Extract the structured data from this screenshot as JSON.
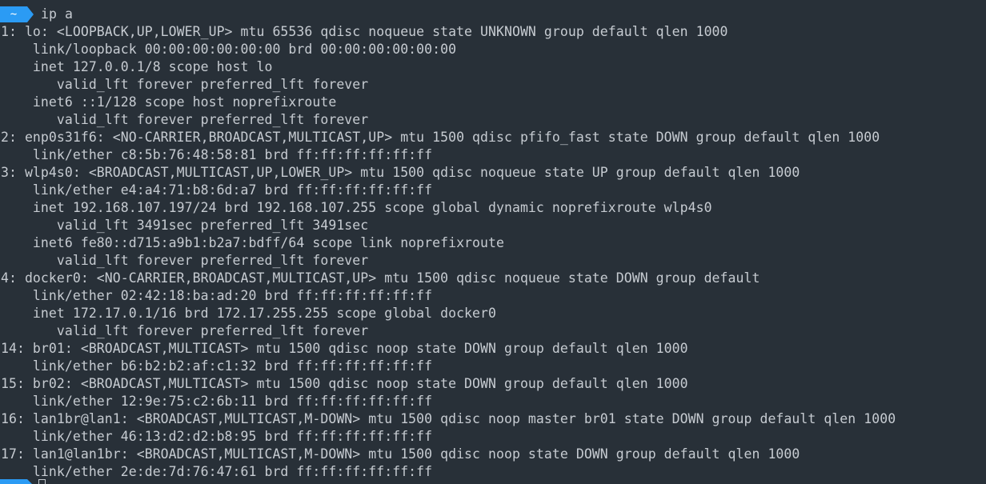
{
  "prompt": {
    "dir": "~",
    "command": "ip a"
  },
  "output": [
    "1: lo: <LOOPBACK,UP,LOWER_UP> mtu 65536 qdisc noqueue state UNKNOWN group default qlen 1000",
    "    link/loopback 00:00:00:00:00:00 brd 00:00:00:00:00:00",
    "    inet 127.0.0.1/8 scope host lo",
    "       valid_lft forever preferred_lft forever",
    "    inet6 ::1/128 scope host noprefixroute",
    "       valid_lft forever preferred_lft forever",
    "2: enp0s31f6: <NO-CARRIER,BROADCAST,MULTICAST,UP> mtu 1500 qdisc pfifo_fast state DOWN group default qlen 1000",
    "    link/ether c8:5b:76:48:58:81 brd ff:ff:ff:ff:ff:ff",
    "3: wlp4s0: <BROADCAST,MULTICAST,UP,LOWER_UP> mtu 1500 qdisc noqueue state UP group default qlen 1000",
    "    link/ether e4:a4:71:b8:6d:a7 brd ff:ff:ff:ff:ff:ff",
    "    inet 192.168.107.197/24 brd 192.168.107.255 scope global dynamic noprefixroute wlp4s0",
    "       valid_lft 3491sec preferred_lft 3491sec",
    "    inet6 fe80::d715:a9b1:b2a7:bdff/64 scope link noprefixroute",
    "       valid_lft forever preferred_lft forever",
    "4: docker0: <NO-CARRIER,BROADCAST,MULTICAST,UP> mtu 1500 qdisc noqueue state DOWN group default",
    "    link/ether 02:42:18:ba:ad:20 brd ff:ff:ff:ff:ff:ff",
    "    inet 172.17.0.1/16 brd 172.17.255.255 scope global docker0",
    "       valid_lft forever preferred_lft forever",
    "14: br01: <BROADCAST,MULTICAST> mtu 1500 qdisc noop state DOWN group default qlen 1000",
    "    link/ether b6:b2:b2:af:c1:32 brd ff:ff:ff:ff:ff:ff",
    "15: br02: <BROADCAST,MULTICAST> mtu 1500 qdisc noop state DOWN group default qlen 1000",
    "    link/ether 12:9e:75:c2:6b:11 brd ff:ff:ff:ff:ff:ff",
    "16: lan1br@lan1: <BROADCAST,MULTICAST,M-DOWN> mtu 1500 qdisc noop master br01 state DOWN group default qlen 1000",
    "    link/ether 46:13:d2:d2:b8:95 brd ff:ff:ff:ff:ff:ff",
    "17: lan1@lan1br: <BROADCAST,MULTICAST,M-DOWN> mtu 1500 qdisc noop state DOWN group default qlen 1000",
    "    link/ether 2e:de:7d:76:47:61 brd ff:ff:ff:ff:ff:ff"
  ],
  "colors": {
    "background": "#283038",
    "text": "#c6cbd1",
    "prompt_accent": "#2b9bf4"
  }
}
